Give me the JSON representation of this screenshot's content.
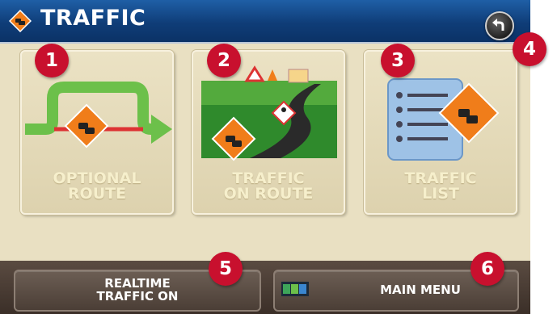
{
  "header": {
    "title": "TRAFFIC",
    "title_icon": "traffic-sign-icon",
    "back_icon": "back-arrow-icon"
  },
  "tiles": [
    {
      "label": "OPTIONAL\nROUTE",
      "icon": "optional-route-icon"
    },
    {
      "label": "TRAFFIC\nON ROUTE",
      "icon": "traffic-on-route-icon"
    },
    {
      "label": "TRAFFIC\nLIST",
      "icon": "traffic-list-icon"
    }
  ],
  "footer": {
    "realtime_label": "REALTIME\nTRAFFIC ON",
    "main_menu_label": "MAIN MENU",
    "main_menu_icon": "main-menu-icon"
  },
  "callouts": [
    "1",
    "2",
    "3",
    "4",
    "5",
    "6"
  ],
  "colors": {
    "title_bar": "#0f3d78",
    "background": "#e9e0c2",
    "callout": "#c8102e",
    "sign": "#f07d1a"
  }
}
